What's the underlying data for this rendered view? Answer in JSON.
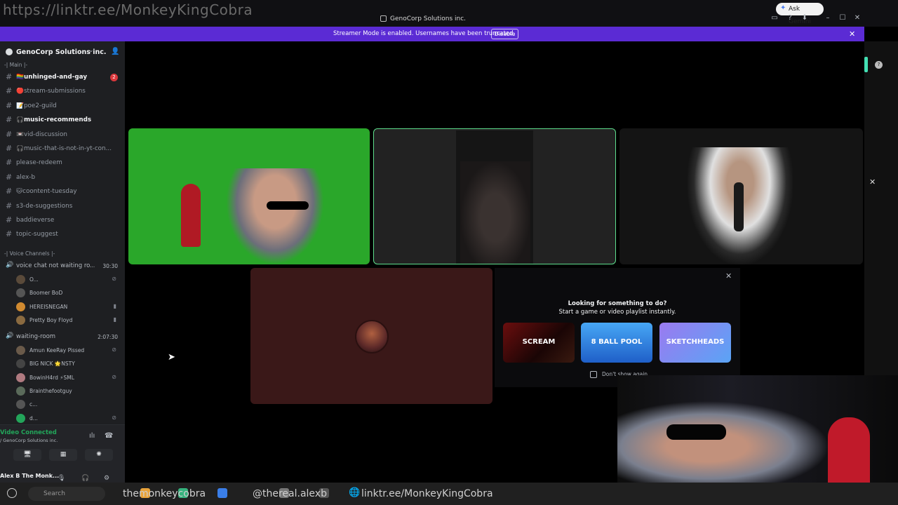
{
  "browser": {
    "url_overlay": "https://linktr.ee/MonkeyKingCobra",
    "ask_gemini": "Ask Gemini"
  },
  "window": {
    "title": "GenoCorp Solutions inc."
  },
  "banner": {
    "text": "Streamer Mode is enabled. Usernames have been truncated.",
    "disable": "Disable"
  },
  "server": {
    "name": "GenoCorp Solutions inc."
  },
  "categories": {
    "main": "-| Main |-",
    "voice": "-| Voice Channels |-"
  },
  "channels": [
    {
      "label": "🏳️‍🌈unhinged-and-gay",
      "unread": true,
      "badge": "2"
    },
    {
      "label": "🔴stream-submissions",
      "unread": false
    },
    {
      "label": "📝poe2-guild",
      "unread": false
    },
    {
      "label": "🎧music-recommends",
      "unread": true
    },
    {
      "label": "📼vid-discussion",
      "unread": false
    },
    {
      "label": "🎧music-that-is-not-in-yt-con...",
      "unread": false
    },
    {
      "label": "please-redeem",
      "unread": false
    },
    {
      "label": "alex-b",
      "unread": false
    },
    {
      "label": "🐱coontent-tuesday",
      "unread": false
    },
    {
      "label": "s3-de-suggestions",
      "unread": false
    },
    {
      "label": "baddieverse",
      "unread": false
    },
    {
      "label": "topic-suggest",
      "unread": false
    }
  ],
  "voice_channels": [
    {
      "label": "voice chat not waiting ro...",
      "time": "30:30",
      "users": [
        "O...",
        "Boomer BoD",
        "HEREISNEGAN",
        "Pretty Boy Floyd"
      ]
    },
    {
      "label": "waiting-room",
      "time": "2:07:30",
      "users": [
        "Amun KeeRay Pissed",
        "BIG NICK 🌟NSTY",
        "BowinH4rd ⚡SML",
        "Brainthefootguy",
        "c...",
        "d..."
      ]
    }
  ],
  "voice_status": {
    "connected": "Video Connected",
    "sub": "/ GenoCorp Solutions inc.",
    "self": "Alex B The Monk..."
  },
  "activity": {
    "title": "Looking for something to do?",
    "subtitle": "Start a game or video playlist instantly.",
    "games": [
      "SCREAM",
      "8 BALL POOL",
      "SKETCHHEADS"
    ],
    "dont_show": "Don't show again"
  },
  "taskbar": {
    "search": "Search",
    "handle1": "themonkeycobra",
    "handle2": "@thereal.alexb",
    "link": "linktr.ee/MonkeyKingCobra"
  },
  "colors": {
    "banner": "#5b2bd4",
    "sidebar": "#1e1f22",
    "speaking_border": "#5dde8c",
    "greenscreen": "#2aa72a",
    "connected": "#23a55a"
  }
}
